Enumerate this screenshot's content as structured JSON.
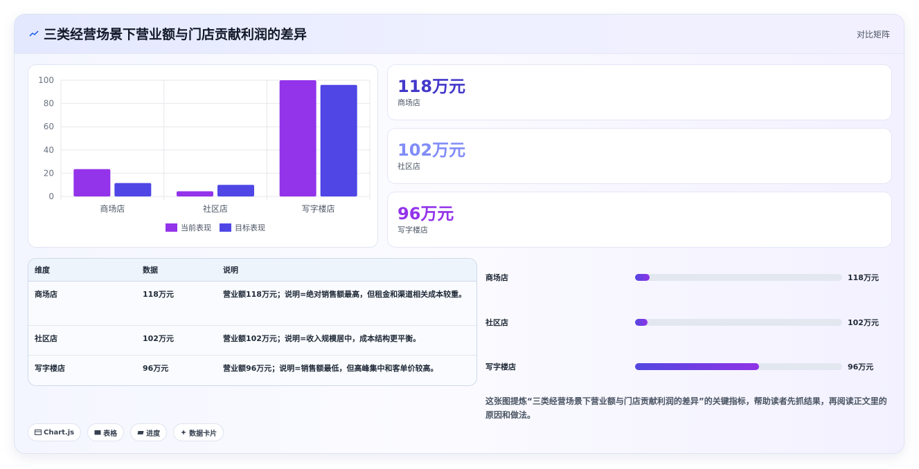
{
  "header": {
    "title": "三类经营场景下营业额与门店贡献利润的差异",
    "badge": "对比矩阵",
    "icon": "trend-icon"
  },
  "chart_data": {
    "type": "bar",
    "categories": [
      "商场店",
      "社区店",
      "写字楼店"
    ],
    "series": [
      {
        "name": "当前表现",
        "values": [
          23.5,
          4.5,
          100
        ],
        "color": "#9333ea"
      },
      {
        "name": "目标表现",
        "values": [
          11.5,
          10,
          96
        ],
        "color": "#4f46e5"
      }
    ],
    "ylim": [
      0,
      100
    ],
    "yticks": [
      0,
      20,
      40,
      60,
      80,
      100
    ],
    "grid": true,
    "legend": "bottom"
  },
  "stats": [
    {
      "value": "118万元",
      "label": "商场店",
      "color": "#4338ca"
    },
    {
      "value": "102万元",
      "label": "社区店",
      "color": "#818cf8"
    },
    {
      "value": "96万元",
      "label": "写字楼店",
      "color": "#9333ea"
    }
  ],
  "table": {
    "headers": [
      "维度",
      "数据",
      "说明"
    ],
    "rows": [
      [
        "商场店",
        "118万元",
        "营业额118万元；说明=绝对销售额最高，但租金和渠道相关成本较重。"
      ],
      [
        "社区店",
        "102万元",
        "营业额102万元；说明=收入规模居中，成本结构更平衡。"
      ],
      [
        "写字楼店",
        "96万元",
        "营业额96万元；说明=销售额最低，但高峰集中和客单价较高。"
      ]
    ]
  },
  "progress": [
    {
      "label": "商场店",
      "value": "118万元",
      "fraction": 0.07
    },
    {
      "label": "社区店",
      "value": "102万元",
      "fraction": 0.06
    },
    {
      "label": "写字楼店",
      "value": "96万元",
      "fraction": 0.6
    }
  ],
  "note": "这张图提炼“三类经营场景下营业额与门店贡献利润的差异”的关键指标，帮助读者先抓结果，再阅读正文里的原因和做法。",
  "tags": [
    {
      "icon": "chart-icon",
      "label": "Chart.js"
    },
    {
      "icon": "table-icon",
      "label": "表格"
    },
    {
      "icon": "progress-icon",
      "label": "进度"
    },
    {
      "icon": "sparkle-icon",
      "label": "数据卡片"
    }
  ]
}
